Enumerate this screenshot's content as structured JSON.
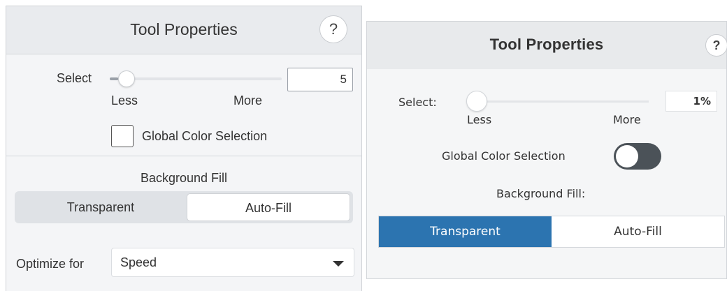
{
  "left_panel": {
    "title": "Tool Properties",
    "help_label": "?",
    "select_label": "Select",
    "select_value": "5",
    "slider_level": 0.05,
    "less_label": "Less",
    "more_label": "More",
    "global_color_label": "Global Color Selection",
    "global_color_checked": false,
    "background_fill_label": "Background Fill",
    "fill_options": [
      "Transparent",
      "Auto-Fill"
    ],
    "fill_selected": "Auto-Fill",
    "optimize_label": "Optimize for",
    "optimize_value": "Speed"
  },
  "right_panel": {
    "title": "Tool Properties",
    "help_label": "?",
    "select_label": "Select:",
    "select_value": "1%",
    "slider_level": 0.01,
    "less_label": "Less",
    "more_label": "More",
    "global_color_label": "Global Color Selection",
    "global_color_on": false,
    "background_fill_label": "Background Fill:",
    "fill_options": [
      "Transparent",
      "Auto-Fill"
    ],
    "fill_selected": "Transparent"
  },
  "colors": {
    "accent_blue": "#2c74b0",
    "toggle_off": "#4b5258"
  }
}
